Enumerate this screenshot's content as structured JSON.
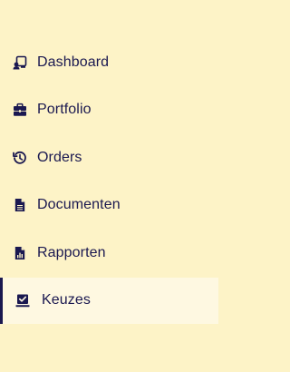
{
  "sidebar": {
    "items": [
      {
        "label": "Dashboard",
        "icon": "dashboard-icon",
        "active": false
      },
      {
        "label": "Portfolio",
        "icon": "briefcase-icon",
        "active": false
      },
      {
        "label": "Orders",
        "icon": "history-icon",
        "active": false
      },
      {
        "label": "Documenten",
        "icon": "document-icon",
        "active": false
      },
      {
        "label": "Rapporten",
        "icon": "report-icon",
        "active": false
      },
      {
        "label": "Keuzes",
        "icon": "check-square-icon",
        "active": true
      }
    ]
  },
  "colors": {
    "background": "#fdf3c7",
    "active_background": "#fef8e1",
    "text": "#1a1850",
    "active_indicator": "#1a1850"
  }
}
